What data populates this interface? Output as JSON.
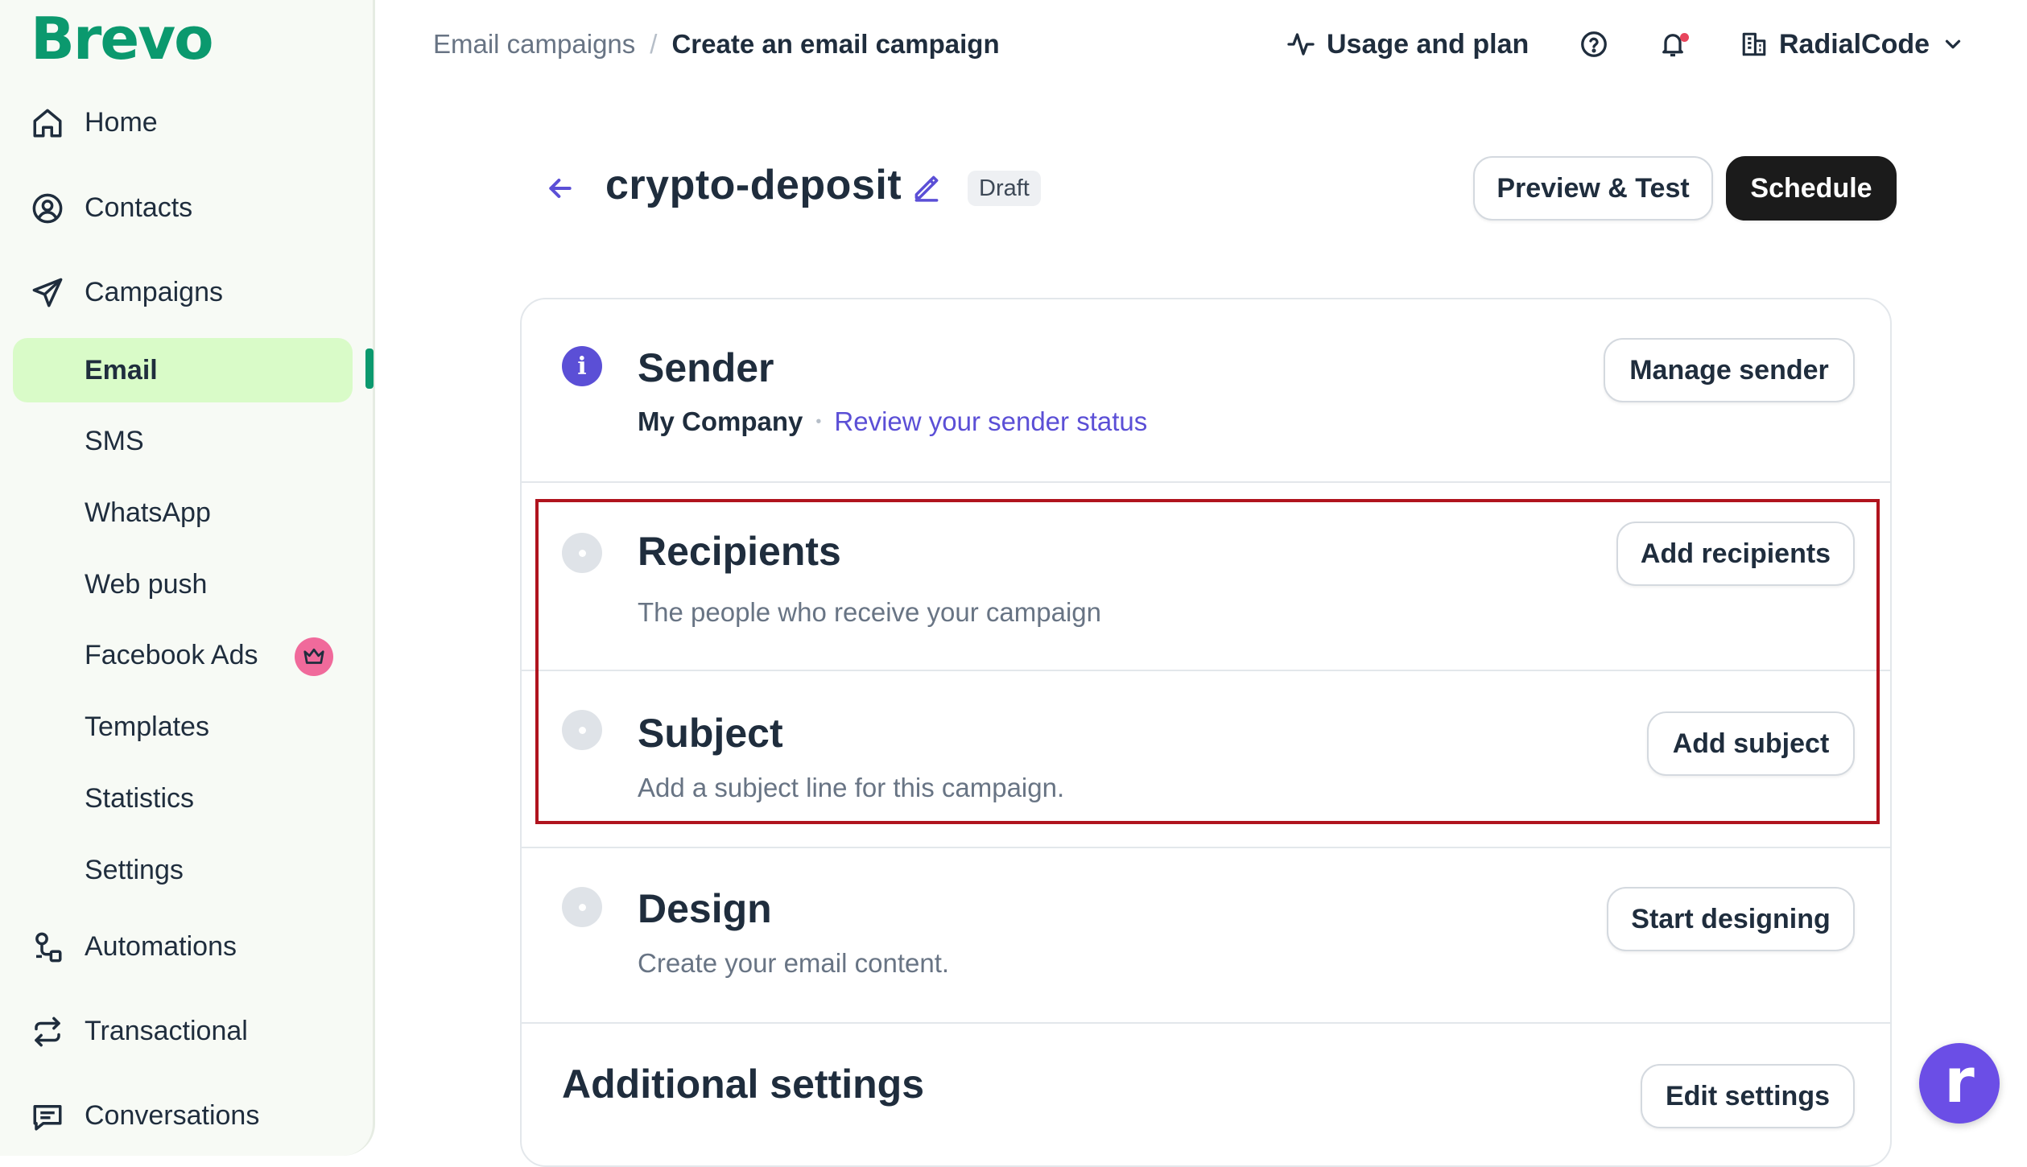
{
  "sidebar": {
    "logo": "Brevo",
    "items": [
      {
        "label": "Home",
        "icon": "home-icon"
      },
      {
        "label": "Contacts",
        "icon": "contacts-icon"
      },
      {
        "label": "Campaigns",
        "icon": "paper-plane-icon"
      },
      {
        "label": "Automations",
        "icon": "automations-icon"
      },
      {
        "label": "Transactional",
        "icon": "transactional-icon"
      },
      {
        "label": "Conversations",
        "icon": "conversations-icon"
      }
    ],
    "campaign_subitems": [
      "Email",
      "SMS",
      "WhatsApp",
      "Web push",
      "Facebook Ads",
      "Templates",
      "Statistics",
      "Settings"
    ],
    "active_subitem": "Email",
    "premium_badge_icon": "crown-icon",
    "brand_color": "#0b996e",
    "active_bg": "#d9fbc8"
  },
  "topbar": {
    "breadcrumb": {
      "parent": "Email campaigns",
      "separator": "/",
      "current": "Create an email campaign"
    },
    "usage_label": "Usage and plan",
    "account_name": "RadialCode"
  },
  "header": {
    "campaign_name": "crypto-deposit",
    "status_badge": "Draft",
    "preview_button": "Preview & Test",
    "schedule_button": "Schedule"
  },
  "sections": {
    "sender": {
      "title": "Sender",
      "company": "My Company",
      "separator": "•",
      "link": "Review your sender status",
      "button": "Manage sender",
      "status_icon": "i"
    },
    "recipients": {
      "title": "Recipients",
      "description": "The people who receive your campaign",
      "button": "Add recipients"
    },
    "subject": {
      "title": "Subject",
      "description": "Add a subject line for this campaign.",
      "button": "Add subject"
    },
    "design": {
      "title": "Design",
      "description": "Create your email content.",
      "button": "Start designing"
    },
    "additional": {
      "title": "Additional settings",
      "button": "Edit settings"
    }
  },
  "fab": {
    "letter": "r",
    "color": "#6b4ee6"
  },
  "colors": {
    "accent": "#5b4fd6",
    "highlight_border": "#b0141e"
  }
}
